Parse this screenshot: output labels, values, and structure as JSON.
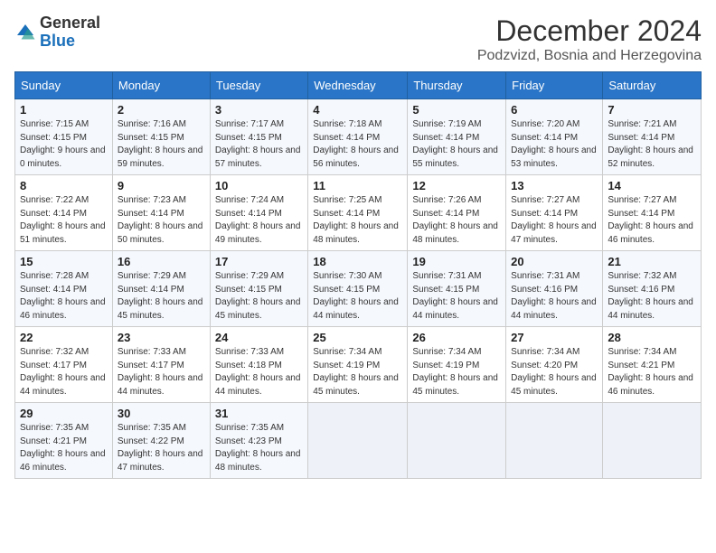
{
  "logo": {
    "general": "General",
    "blue": "Blue"
  },
  "title": "December 2024",
  "location": "Podzvizd, Bosnia and Herzegovina",
  "weekdays": [
    "Sunday",
    "Monday",
    "Tuesday",
    "Wednesday",
    "Thursday",
    "Friday",
    "Saturday"
  ],
  "weeks": [
    [
      {
        "day": "1",
        "sunrise": "7:15 AM",
        "sunset": "4:15 PM",
        "daylight": "9 hours and 0 minutes."
      },
      {
        "day": "2",
        "sunrise": "7:16 AM",
        "sunset": "4:15 PM",
        "daylight": "8 hours and 59 minutes."
      },
      {
        "day": "3",
        "sunrise": "7:17 AM",
        "sunset": "4:15 PM",
        "daylight": "8 hours and 57 minutes."
      },
      {
        "day": "4",
        "sunrise": "7:18 AM",
        "sunset": "4:14 PM",
        "daylight": "8 hours and 56 minutes."
      },
      {
        "day": "5",
        "sunrise": "7:19 AM",
        "sunset": "4:14 PM",
        "daylight": "8 hours and 55 minutes."
      },
      {
        "day": "6",
        "sunrise": "7:20 AM",
        "sunset": "4:14 PM",
        "daylight": "8 hours and 53 minutes."
      },
      {
        "day": "7",
        "sunrise": "7:21 AM",
        "sunset": "4:14 PM",
        "daylight": "8 hours and 52 minutes."
      }
    ],
    [
      {
        "day": "8",
        "sunrise": "7:22 AM",
        "sunset": "4:14 PM",
        "daylight": "8 hours and 51 minutes."
      },
      {
        "day": "9",
        "sunrise": "7:23 AM",
        "sunset": "4:14 PM",
        "daylight": "8 hours and 50 minutes."
      },
      {
        "day": "10",
        "sunrise": "7:24 AM",
        "sunset": "4:14 PM",
        "daylight": "8 hours and 49 minutes."
      },
      {
        "day": "11",
        "sunrise": "7:25 AM",
        "sunset": "4:14 PM",
        "daylight": "8 hours and 48 minutes."
      },
      {
        "day": "12",
        "sunrise": "7:26 AM",
        "sunset": "4:14 PM",
        "daylight": "8 hours and 48 minutes."
      },
      {
        "day": "13",
        "sunrise": "7:27 AM",
        "sunset": "4:14 PM",
        "daylight": "8 hours and 47 minutes."
      },
      {
        "day": "14",
        "sunrise": "7:27 AM",
        "sunset": "4:14 PM",
        "daylight": "8 hours and 46 minutes."
      }
    ],
    [
      {
        "day": "15",
        "sunrise": "7:28 AM",
        "sunset": "4:14 PM",
        "daylight": "8 hours and 46 minutes."
      },
      {
        "day": "16",
        "sunrise": "7:29 AM",
        "sunset": "4:14 PM",
        "daylight": "8 hours and 45 minutes."
      },
      {
        "day": "17",
        "sunrise": "7:29 AM",
        "sunset": "4:15 PM",
        "daylight": "8 hours and 45 minutes."
      },
      {
        "day": "18",
        "sunrise": "7:30 AM",
        "sunset": "4:15 PM",
        "daylight": "8 hours and 44 minutes."
      },
      {
        "day": "19",
        "sunrise": "7:31 AM",
        "sunset": "4:15 PM",
        "daylight": "8 hours and 44 minutes."
      },
      {
        "day": "20",
        "sunrise": "7:31 AM",
        "sunset": "4:16 PM",
        "daylight": "8 hours and 44 minutes."
      },
      {
        "day": "21",
        "sunrise": "7:32 AM",
        "sunset": "4:16 PM",
        "daylight": "8 hours and 44 minutes."
      }
    ],
    [
      {
        "day": "22",
        "sunrise": "7:32 AM",
        "sunset": "4:17 PM",
        "daylight": "8 hours and 44 minutes."
      },
      {
        "day": "23",
        "sunrise": "7:33 AM",
        "sunset": "4:17 PM",
        "daylight": "8 hours and 44 minutes."
      },
      {
        "day": "24",
        "sunrise": "7:33 AM",
        "sunset": "4:18 PM",
        "daylight": "8 hours and 44 minutes."
      },
      {
        "day": "25",
        "sunrise": "7:34 AM",
        "sunset": "4:19 PM",
        "daylight": "8 hours and 45 minutes."
      },
      {
        "day": "26",
        "sunrise": "7:34 AM",
        "sunset": "4:19 PM",
        "daylight": "8 hours and 45 minutes."
      },
      {
        "day": "27",
        "sunrise": "7:34 AM",
        "sunset": "4:20 PM",
        "daylight": "8 hours and 45 minutes."
      },
      {
        "day": "28",
        "sunrise": "7:34 AM",
        "sunset": "4:21 PM",
        "daylight": "8 hours and 46 minutes."
      }
    ],
    [
      {
        "day": "29",
        "sunrise": "7:35 AM",
        "sunset": "4:21 PM",
        "daylight": "8 hours and 46 minutes."
      },
      {
        "day": "30",
        "sunrise": "7:35 AM",
        "sunset": "4:22 PM",
        "daylight": "8 hours and 47 minutes."
      },
      {
        "day": "31",
        "sunrise": "7:35 AM",
        "sunset": "4:23 PM",
        "daylight": "8 hours and 48 minutes."
      },
      null,
      null,
      null,
      null
    ]
  ],
  "labels": {
    "sunrise": "Sunrise:",
    "sunset": "Sunset:",
    "daylight": "Daylight:"
  }
}
